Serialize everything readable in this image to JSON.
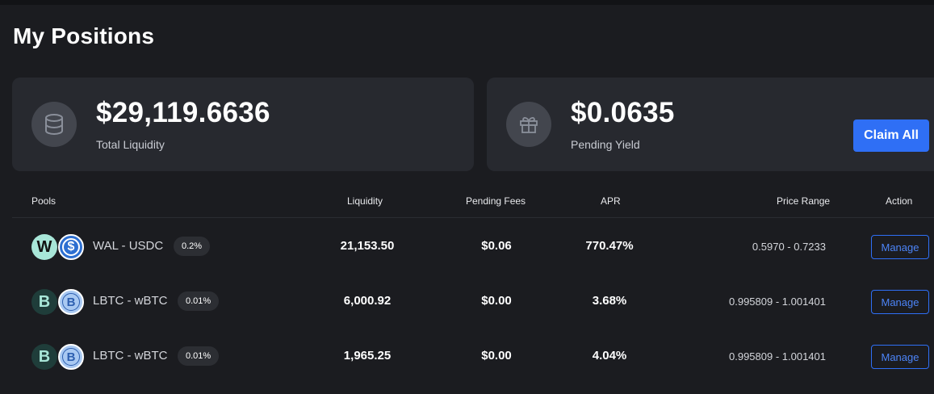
{
  "page": {
    "title": "My Positions"
  },
  "summary": {
    "liquidity": {
      "value": "$29,119.6636",
      "label": "Total Liquidity",
      "icon": "database-icon"
    },
    "yield": {
      "value": "$0.0635",
      "label": "Pending Yield",
      "icon": "gift-icon"
    },
    "claim_label": "Claim All"
  },
  "table": {
    "headers": {
      "pools": "Pools",
      "liquidity": "Liquidity",
      "pending_fees": "Pending Fees",
      "apr": "APR",
      "price_range": "Price Range",
      "action": "Action"
    },
    "rows": [
      {
        "token_a": {
          "name": "wal-token-icon",
          "glyph": "W"
        },
        "token_b": {
          "name": "usdc-token-icon",
          "glyph": "$"
        },
        "pair": "WAL - USDC",
        "fee": "0.2%",
        "liquidity": "21,153.50",
        "pending_fees": "$0.06",
        "apr": "770.47%",
        "price_range": "0.5970 - 0.7233",
        "action": "Manage"
      },
      {
        "token_a": {
          "name": "lbtc-token-icon",
          "glyph": "B"
        },
        "token_b": {
          "name": "wbtc-token-icon",
          "glyph": "B"
        },
        "pair": "LBTC - wBTC",
        "fee": "0.01%",
        "liquidity": "6,000.92",
        "pending_fees": "$0.00",
        "apr": "3.68%",
        "price_range": "0.995809 - 1.001401",
        "action": "Manage"
      },
      {
        "token_a": {
          "name": "lbtc-token-icon",
          "glyph": "B"
        },
        "token_b": {
          "name": "wbtc-token-icon",
          "glyph": "B"
        },
        "pair": "LBTC - wBTC",
        "fee": "0.01%",
        "liquidity": "1,965.25",
        "pending_fees": "$0.00",
        "apr": "4.04%",
        "price_range": "0.995809 - 1.001401",
        "action": "Manage"
      }
    ]
  },
  "colors": {
    "background": "#1b1c20",
    "card": "#27292f",
    "accent": "#2f6ff5",
    "wal_token": "#a8e6d8",
    "usdc_token": "#2d6fd1",
    "lbtc_token": "#1f3d3a",
    "wbtc_token": "#a9c9f2"
  }
}
